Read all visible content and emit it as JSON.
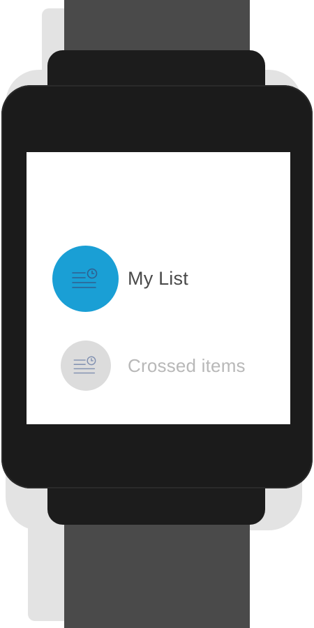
{
  "watch": {
    "menu": [
      {
        "label": "My List",
        "icon": "list-clock-icon",
        "active": true,
        "color": "#1a9fd5"
      },
      {
        "label": "Crossed items",
        "icon": "list-clock-icon",
        "active": false,
        "color": "#dcdcdc"
      }
    ]
  }
}
